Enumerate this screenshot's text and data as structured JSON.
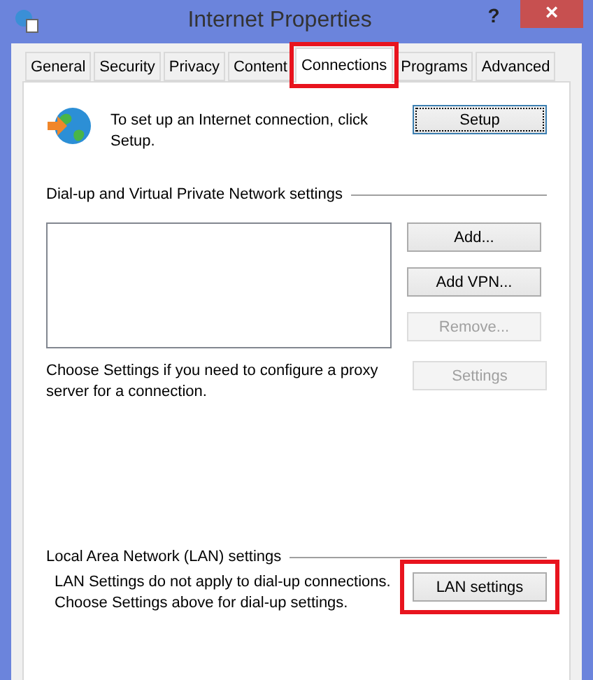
{
  "window": {
    "title": "Internet Properties",
    "help": "?",
    "close": "×"
  },
  "tabs": [
    {
      "label": "General",
      "selected": false,
      "highlighted": false
    },
    {
      "label": "Security",
      "selected": false,
      "highlighted": false
    },
    {
      "label": "Privacy",
      "selected": false,
      "highlighted": false
    },
    {
      "label": "Content",
      "selected": false,
      "highlighted": false
    },
    {
      "label": "Connections",
      "selected": true,
      "highlighted": true
    },
    {
      "label": "Programs",
      "selected": false,
      "highlighted": false
    },
    {
      "label": "Advanced",
      "selected": false,
      "highlighted": false
    }
  ],
  "setup": {
    "text": "To set up an Internet connection, click Setup.",
    "button": {
      "label": "Setup",
      "disabled": false,
      "focused": true
    }
  },
  "dialup": {
    "heading": "Dial-up and Virtual Private Network settings",
    "buttons": [
      {
        "label": "Add...",
        "disabled": false,
        "focused": false
      },
      {
        "label": "Add VPN...",
        "disabled": false,
        "focused": false
      },
      {
        "label": "Remove...",
        "disabled": true,
        "focused": false
      }
    ],
    "proxy_text": "Choose Settings if you need to configure a proxy server for a connection.",
    "settings_button": {
      "label": "Settings",
      "disabled": true,
      "focused": false
    }
  },
  "lan": {
    "heading": "Local Area Network (LAN) settings",
    "text": "LAN Settings do not apply to dial-up connections. Choose Settings above for dial-up settings.",
    "button": {
      "label": "LAN settings",
      "disabled": false,
      "focused": false
    },
    "button_highlighted": true
  }
}
